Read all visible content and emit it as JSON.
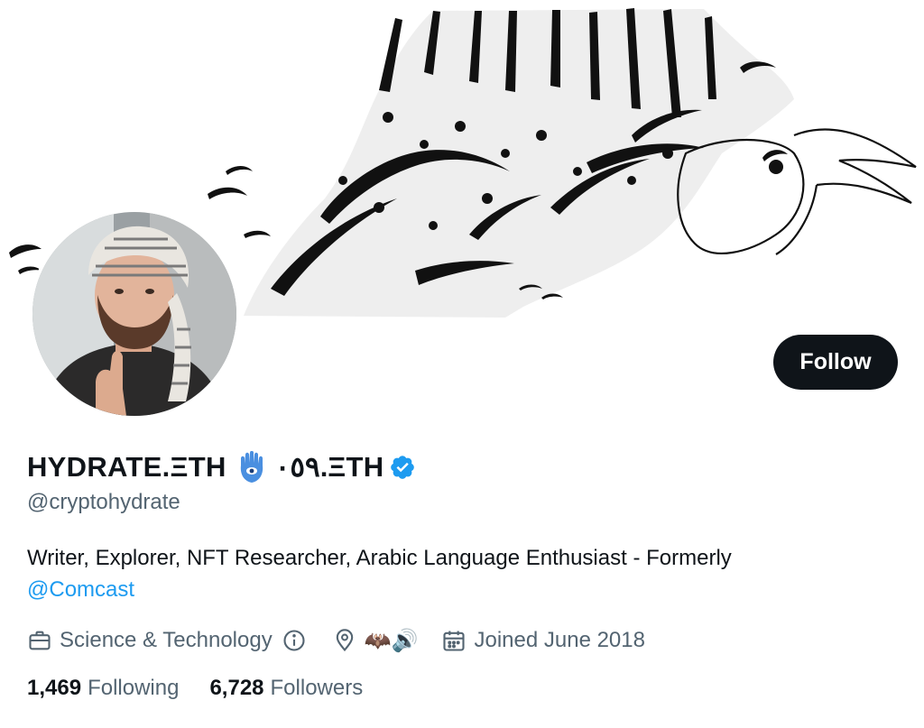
{
  "profile": {
    "name_part1": "HYDRATE.ΞTH",
    "name_part2": "٠٥٩.ΞTH",
    "handle": "@cryptohydrate",
    "bio_text": "Writer, Explorer, NFT Researcher, Arabic Language Enthusiast - Formerly",
    "bio_mention": "@Comcast",
    "verified": true
  },
  "actions": {
    "follow_label": "Follow"
  },
  "meta": {
    "category": "Science & Technology",
    "location_emoji": "🦇🔊",
    "joined": "Joined June 2018"
  },
  "stats": {
    "following_count": "1,469",
    "following_label": "Following",
    "followers_count": "6,728",
    "followers_label": "Followers"
  },
  "icons": {
    "category": "briefcase-icon",
    "info": "info-icon",
    "location": "location-pin-icon",
    "calendar": "calendar-icon",
    "verified": "verified-badge-icon",
    "name_emoji": "hamsa-icon"
  },
  "colors": {
    "accent": "#1d9bf0",
    "text_primary": "#0f1419",
    "text_secondary": "#536471",
    "button_bg": "#0f1419"
  }
}
